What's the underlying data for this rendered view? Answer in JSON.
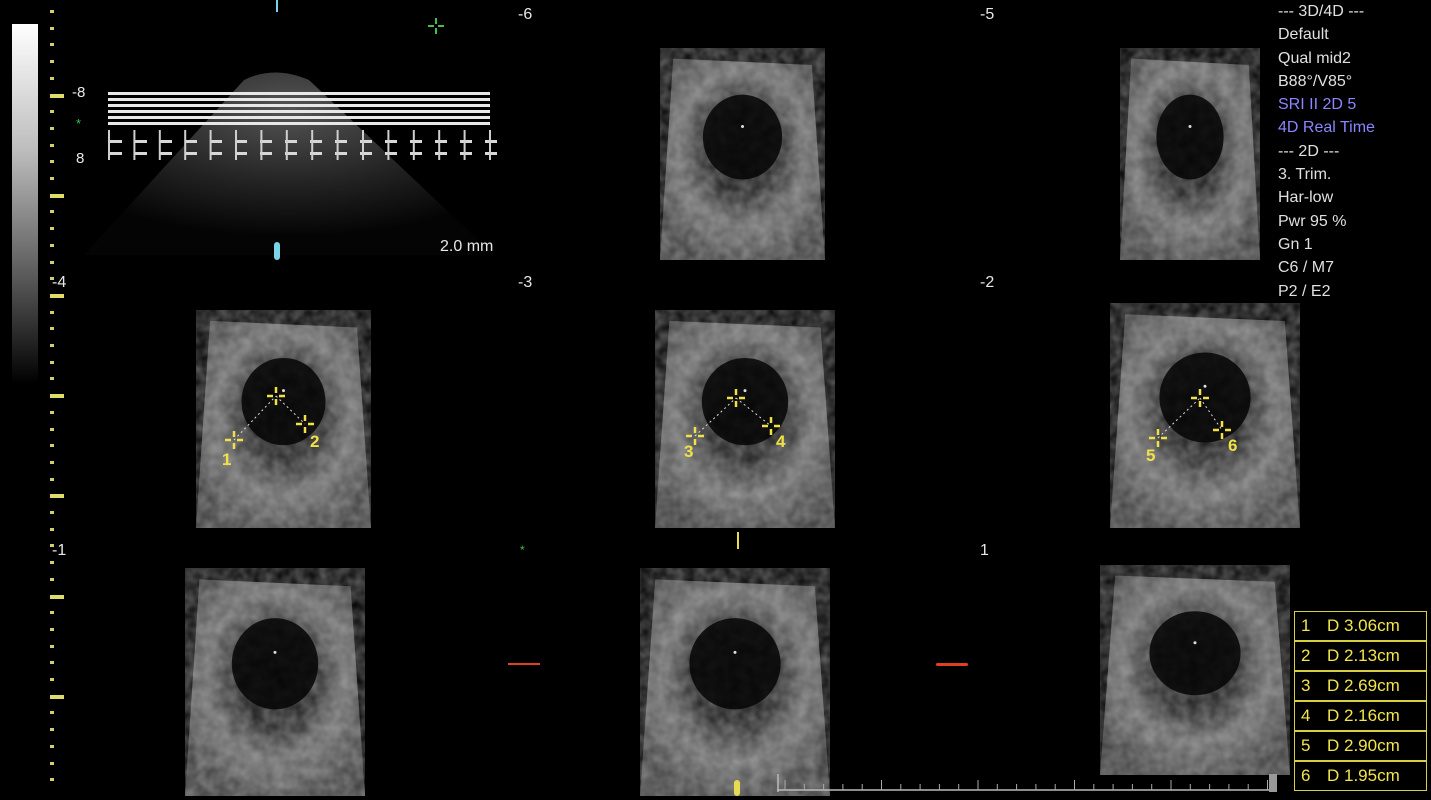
{
  "slice_labels": [
    "-6",
    "-5",
    "-4",
    "-3",
    "-2",
    "-1",
    "1"
  ],
  "scale_labels": [
    "-8",
    "8"
  ],
  "ref_depth": "2.0 mm",
  "info_panel": {
    "lines": [
      {
        "text": "--- 3D/4D ---",
        "color": "#e0e0e0"
      },
      {
        "text": "Default",
        "color": "#e0e0e0"
      },
      {
        "text": "Qual mid2",
        "color": "#e0e0e0"
      },
      {
        "text": "B88°/V85°",
        "color": "#e0e0e0"
      },
      {
        "text": "SRI II 2D 5",
        "color": "#8a86ff"
      },
      {
        "text": "4D Real Time",
        "color": "#8a86ff"
      },
      {
        "text": "",
        "color": "#e0e0e0"
      },
      {
        "text": "--- 2D ---",
        "color": "#e0e0e0"
      },
      {
        "text": "3. Trim.",
        "color": "#e0e0e0"
      },
      {
        "text": "Har-low",
        "color": "#e0e0e0"
      },
      {
        "text": "Pwr  95 %",
        "color": "#e0e0e0"
      },
      {
        "text": "Gn   1",
        "color": "#e0e0e0"
      },
      {
        "text": "C6 / M7",
        "color": "#e0e0e0"
      },
      {
        "text": "P2 / E2",
        "color": "#e0e0e0"
      }
    ]
  },
  "measurements": [
    {
      "id": "1",
      "label": "D 3.06cm"
    },
    {
      "id": "2",
      "label": "D 2.13cm"
    },
    {
      "id": "3",
      "label": "D 2.69cm"
    },
    {
      "id": "4",
      "label": "D 2.16cm"
    },
    {
      "id": "5",
      "label": "D 2.90cm"
    },
    {
      "id": "6",
      "label": "D 1.95cm"
    }
  ],
  "caliper_labels": [
    "1",
    "2",
    "3",
    "4",
    "5",
    "6"
  ],
  "colors": {
    "caliper": "#f0e246",
    "info_blue": "#8a86ff",
    "marker_red": "#e0401e",
    "marker_green": "#3ec24a",
    "marker_cyan": "#7ad4e8"
  }
}
